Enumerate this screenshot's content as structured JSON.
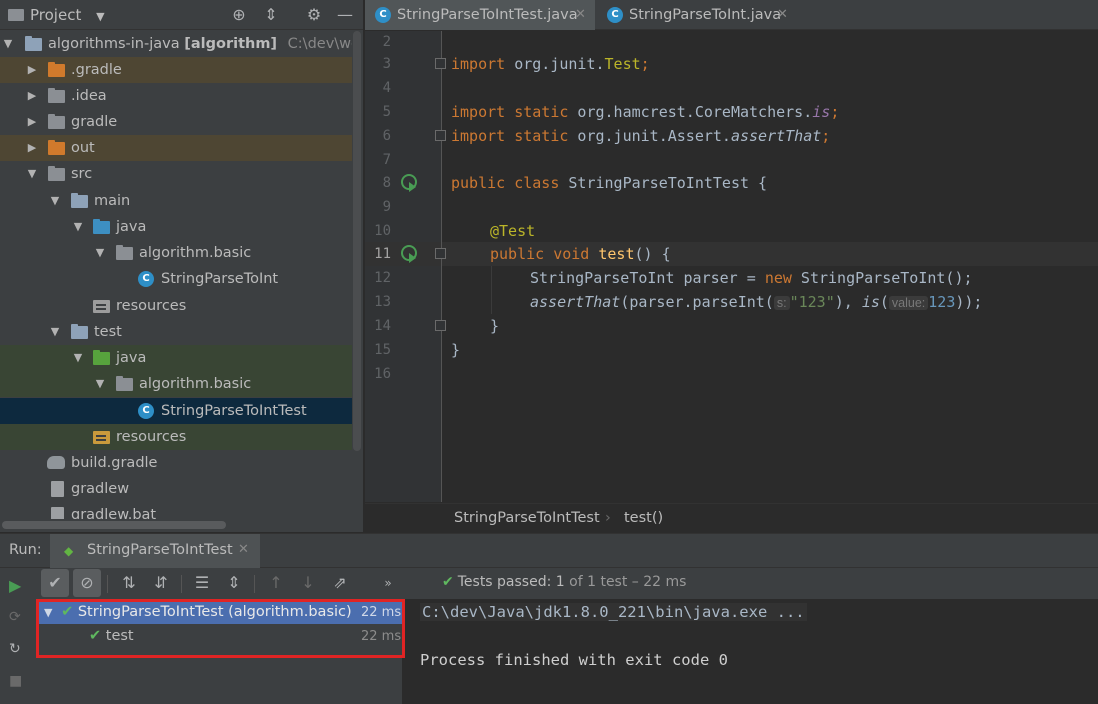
{
  "project_panel": {
    "title": "Project",
    "tree": [
      {
        "label": "algorithms-in-java",
        "module": "[algorithm]",
        "path": "C:\\dev\\works"
      },
      {
        "label": ".gradle"
      },
      {
        "label": ".idea"
      },
      {
        "label": "gradle"
      },
      {
        "label": "out"
      },
      {
        "label": "src"
      },
      {
        "label": "main"
      },
      {
        "label": "java"
      },
      {
        "label": "algorithm.basic"
      },
      {
        "label": "StringParseToInt"
      },
      {
        "label": "resources"
      },
      {
        "label": "test"
      },
      {
        "label": "java"
      },
      {
        "label": "algorithm.basic"
      },
      {
        "label": "StringParseToIntTest"
      },
      {
        "label": "resources"
      },
      {
        "label": "build.gradle"
      },
      {
        "label": "gradlew"
      },
      {
        "label": "gradlew.bat"
      }
    ]
  },
  "editor": {
    "tabs": [
      {
        "label": "StringParseToIntTest.java",
        "active": true
      },
      {
        "label": "StringParseToInt.java",
        "active": false
      }
    ],
    "line_numbers": [
      "2",
      "3",
      "4",
      "5",
      "6",
      "7",
      "8",
      "9",
      "10",
      "11",
      "12",
      "13",
      "14",
      "15",
      "16"
    ],
    "code": {
      "l3_kw": "import",
      "l3_rest": " org.junit.",
      "l3_cls": "Test",
      "l3_end": ";",
      "l5_kw": "import static",
      "l5_rest": " org.hamcrest.CoreMatchers.",
      "l5_m": "is",
      "l5_end": ";",
      "l6_kw": "import static",
      "l6_rest": " org.junit.Assert.",
      "l6_m": "assertThat",
      "l6_end": ";",
      "l8_kw": "public class",
      "l8_rest": " StringParseToIntTest {",
      "l10_an": "@Test",
      "l11_kw": "public void",
      "l11_fn": "test",
      "l11_rest": "() {",
      "l12_a": "StringParseToInt parser = ",
      "l12_kw": "new",
      "l12_b": " StringParseToInt();",
      "l13_a": "assertThat",
      "l13_b": "(parser.parseInt(",
      "l13_hint1": "s:",
      "l13_str": "\"123\"",
      "l13_c": "), ",
      "l13_is": "is",
      "l13_d": "(",
      "l13_hint2": "value:",
      "l13_num": "123",
      "l13_e": "));",
      "l14": "}",
      "l15": "}"
    },
    "breadcrumb": {
      "class": "StringParseToIntTest",
      "separator": "›",
      "method": "test()"
    }
  },
  "run_panel": {
    "label": "Run:",
    "tab": "StringParseToIntTest",
    "status": {
      "prefix": "Tests passed:",
      "count": "1",
      "suffix": "of 1 test – 22 ms"
    },
    "tests": [
      {
        "name": "StringParseToIntTest (algorithm.basic)",
        "time": "22 ms"
      },
      {
        "name": "test",
        "time": "22 ms"
      }
    ],
    "console": [
      "C:\\dev\\Java\\jdk1.8.0_221\\bin\\java.exe ...",
      "Process finished with exit code 0"
    ]
  },
  "colors": {
    "accent_selection": "#4b6eaf",
    "pass_green": "#5fb85f",
    "highlight_red": "#e02424",
    "keyword": "#cc7832",
    "string": "#6a8759",
    "number": "#6897bb"
  }
}
